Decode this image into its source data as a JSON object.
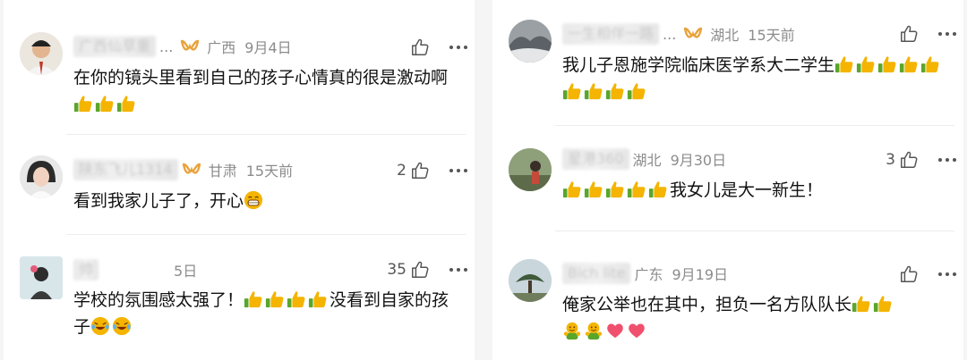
{
  "left": [
    {
      "name": "广西仙草重",
      "truncated": true,
      "region": "广西",
      "time": "9月4日",
      "likes": "",
      "text": "在你的镜头里看到自己的孩子心情真的很是激动啊",
      "emoji_suffix": [
        "thumbs-up",
        "thumbs-up",
        "thumbs-up"
      ]
    },
    {
      "name": "陕东飞儿1314",
      "truncated": false,
      "region": "甘肃",
      "time": "15天前",
      "likes": "2",
      "text": "看到我家儿子了，开心",
      "emoji_suffix": [
        "grin"
      ]
    },
    {
      "name": "帅",
      "truncated": false,
      "region": "",
      "time": "5日",
      "likes": "35",
      "text": "学校的氛围感太强了！",
      "emoji_mid": [
        "thumbs-up",
        "thumbs-up",
        "thumbs-up",
        "thumbs-up"
      ],
      "text2": "没看到自家的孩子",
      "emoji_suffix": [
        "laugh-cry",
        "laugh-cry"
      ]
    }
  ],
  "right": [
    {
      "name": "一生相伴一路",
      "truncated": true,
      "region": "湖北",
      "time": "15天前",
      "likes": "",
      "text": "我儿子恩施学院临床医学系大二学生",
      "emoji_suffix": [
        "thumbs-up",
        "thumbs-up",
        "thumbs-up",
        "thumbs-up",
        "thumbs-up",
        "thumbs-up",
        "thumbs-up",
        "thumbs-up",
        "thumbs-up"
      ]
    },
    {
      "name": "星港360",
      "truncated": false,
      "region": "湖北",
      "time": "9月30日",
      "likes": "3",
      "emoji_prefix": [
        "thumbs-up",
        "thumbs-up",
        "thumbs-up",
        "thumbs-up",
        "thumbs-up"
      ],
      "text": "我女儿是大一新生！"
    },
    {
      "name": "Bich lite",
      "truncated": false,
      "region": "广东",
      "time": "9月19日",
      "likes": "",
      "text": "俺家公举也在其中，担负一名方队队长",
      "emoji_suffix": [
        "thumbs-up",
        "thumbs-up",
        "hug",
        "hug",
        "heart",
        "heart"
      ]
    }
  ],
  "colors": {
    "meta": "#8c8c8c",
    "badge": "#e8a33d",
    "emoji_yellow": "#f4b400",
    "emoji_green": "#5aa62a",
    "heart": "#f0506e"
  }
}
